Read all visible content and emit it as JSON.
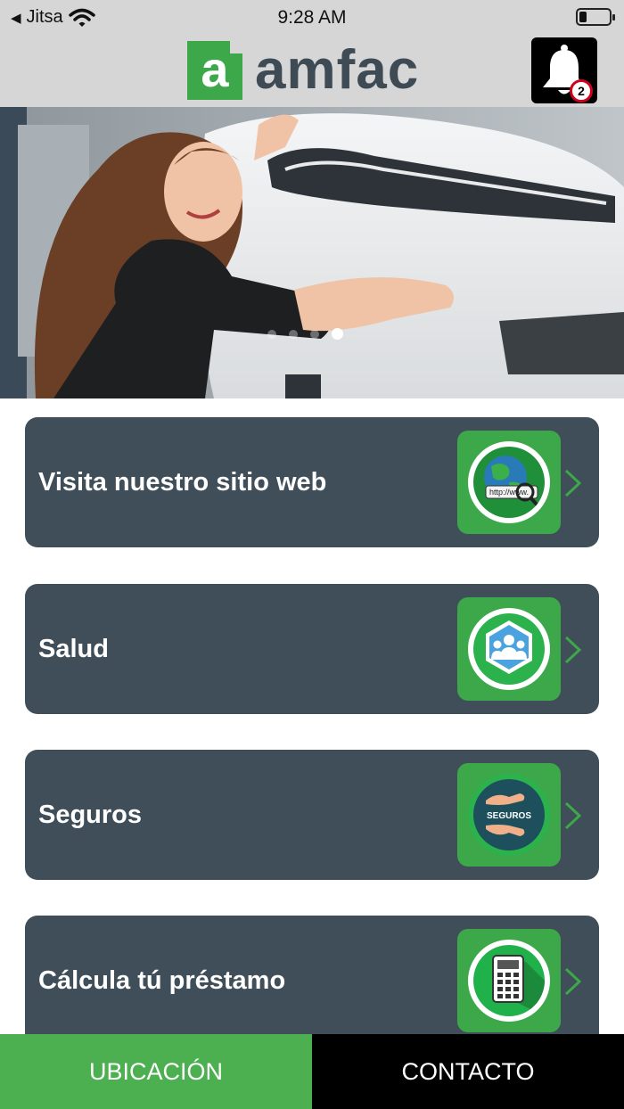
{
  "status_bar": {
    "back_indicator": "◀",
    "carrier": "Jitsa",
    "time": "9:28 AM",
    "wifi_icon": "wifi-icon",
    "battery_level": 0.25
  },
  "header": {
    "logo_mark": "a",
    "logo_text": "amfac",
    "notification_count": "2",
    "brand_green": "#3da84a",
    "brand_dark": "#3e4b55"
  },
  "hero": {
    "slide_count": 4,
    "active_slide": 4
  },
  "menu": {
    "items": [
      {
        "label": "Visita nuestro sitio web",
        "icon": "website-globe-icon"
      },
      {
        "label": "Salud",
        "icon": "health-people-icon"
      },
      {
        "label": "Seguros",
        "icon": "insurance-hands-icon",
        "icon_text": "SEGUROS"
      },
      {
        "label": "Cálcula tú préstamo",
        "icon": "calculator-icon"
      }
    ],
    "card_color": "#3f4e58",
    "chevron_color": "#3da84a"
  },
  "bottom_bar": {
    "location_label": "UBICACIÓN",
    "contact_label": "CONTACTO",
    "location_color": "#4caf50",
    "contact_color": "#000000"
  }
}
